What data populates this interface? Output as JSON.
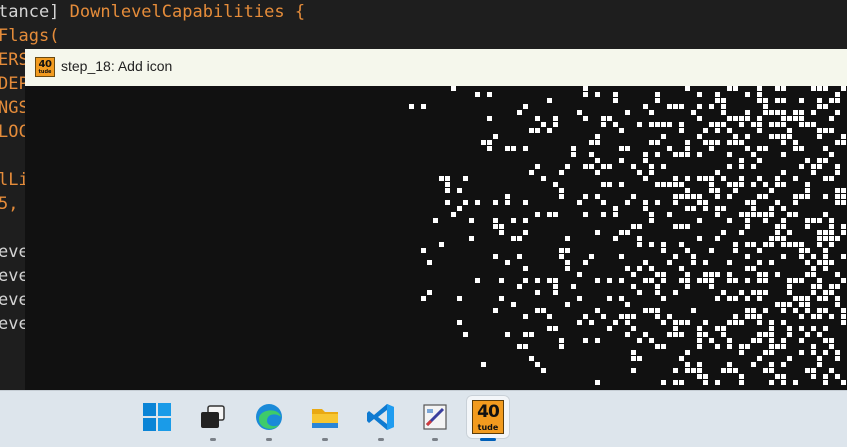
{
  "editor": {
    "lines": [
      {
        "a": "tance]",
        "b": " DownlevelCapabilities {"
      },
      {
        "a": "",
        "b": "Flags("
      },
      {
        "a": "",
        "b": "ERS"
      },
      {
        "a": "",
        "b": "DEP"
      },
      {
        "a": "",
        "b": "NGS"
      },
      {
        "a": "",
        "b": "LOC"
      },
      {
        "a": "",
        "b": ""
      },
      {
        "a": "",
        "b": "lLi"
      },
      {
        "a": "",
        "b": "5,"
      },
      {
        "a": "",
        "b": ""
      },
      {
        "a": "eve",
        "b": ""
      },
      {
        "a": "eve",
        "b": ""
      },
      {
        "a": "eve",
        "b": ""
      },
      {
        "a": "eve",
        "b": ""
      }
    ]
  },
  "window": {
    "title": "step_18: Add icon",
    "icon": {
      "name": "40tude-logo",
      "num": "40",
      "word": "tude",
      "color": "#f29b1f"
    }
  },
  "taskbar": {
    "items": [
      {
        "name": "windows-start-icon",
        "active": false,
        "running": false
      },
      {
        "name": "task-view-icon",
        "active": false,
        "running": true
      },
      {
        "name": "edge-browser-icon",
        "active": false,
        "running": true
      },
      {
        "name": "file-explorer-icon",
        "active": false,
        "running": true
      },
      {
        "name": "vscode-icon",
        "active": false,
        "running": true
      },
      {
        "name": "paint-app-icon",
        "active": false,
        "running": true
      },
      {
        "name": "40tude-app-icon",
        "active": true,
        "running": true
      }
    ],
    "app_label_num": "40",
    "app_label_word": "tude"
  }
}
